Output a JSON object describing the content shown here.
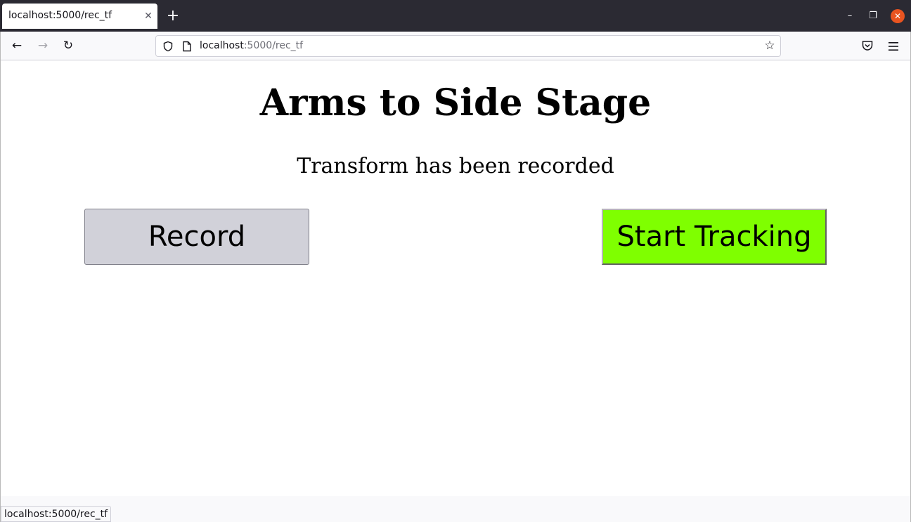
{
  "browser": {
    "tab_title": "localhost:5000/rec_tf",
    "tab_close_glyph": "✕",
    "new_tab_glyph": "+",
    "window": {
      "minimize_glyph": "–",
      "maximize_glyph": "❐",
      "close_glyph": "✕"
    },
    "nav": {
      "back_glyph": "←",
      "forward_glyph": "→",
      "reload_glyph": "↻"
    },
    "url_host": "localhost",
    "url_rest": ":5000/rec_tf",
    "bookmark_glyph": "☆",
    "status_url": "localhost:5000/rec_tf"
  },
  "page": {
    "title": "Arms to Side Stage",
    "status": "Transform has been recorded",
    "record_button": "Record",
    "start_tracking_button": "Start Tracking"
  },
  "colors": {
    "record_button": "#d1d1d9",
    "start_tracking_button": "#7fff00",
    "window_close": "#e95420"
  },
  "icons": {
    "tab_close": "close-icon",
    "new_tab": "plus-icon",
    "back": "arrow-left-icon",
    "forward": "arrow-right-icon",
    "reload": "reload-icon",
    "tracking_protection": "shield-icon",
    "page_info": "page-icon",
    "bookmark": "star-icon",
    "pocket": "pocket-icon",
    "menu": "hamburger-menu-icon"
  }
}
